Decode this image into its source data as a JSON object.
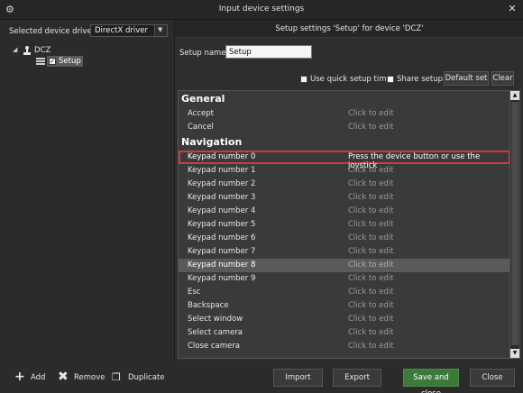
{
  "window": {
    "title": "Input device settings",
    "close_glyph": "✕",
    "icon": "gear-icon"
  },
  "left": {
    "driver_label": "Selected device driver:",
    "driver_value": "DirectX driver",
    "tree": {
      "device": "DCZ",
      "setup": "Setup"
    }
  },
  "right": {
    "header": "Setup settings 'Setup' for device 'DCZ'",
    "setup_name_label": "Setup name:",
    "setup_name_value": "Setup",
    "quick_setup_label": "Use quick setup time",
    "share_setup_label": "Share setup",
    "default_set_label": "Default set",
    "clear_label": "Clear"
  },
  "list": {
    "sections": [
      {
        "title": "General",
        "rows": [
          {
            "name": "Accept",
            "value": "Click to edit"
          },
          {
            "name": "Cancel",
            "value": "Click to edit"
          }
        ]
      },
      {
        "title": "Navigation",
        "rows": [
          {
            "name": "Keypad number 0",
            "value": "Press the device button or use the joystick"
          },
          {
            "name": "Keypad number 1",
            "value": "Click to edit"
          },
          {
            "name": "Keypad number 2",
            "value": "Click to edit"
          },
          {
            "name": "Keypad number 3",
            "value": "Click to edit"
          },
          {
            "name": "Keypad number 4",
            "value": "Click to edit"
          },
          {
            "name": "Keypad number 5",
            "value": "Click to edit"
          },
          {
            "name": "Keypad number 6",
            "value": "Click to edit"
          },
          {
            "name": "Keypad number 7",
            "value": "Click to edit"
          },
          {
            "name": "Keypad number 8",
            "value": "Click to edit"
          },
          {
            "name": "Keypad number 9",
            "value": "Click to edit"
          },
          {
            "name": "Esc",
            "value": "Click to edit"
          },
          {
            "name": "Backspace",
            "value": "Click to edit"
          },
          {
            "name": "Select window",
            "value": "Click to edit"
          },
          {
            "name": "Select camera",
            "value": "Click to edit"
          },
          {
            "name": "Close camera",
            "value": "Click to edit"
          }
        ]
      }
    ]
  },
  "bottom": {
    "add_label": "Add",
    "remove_label": "Remove",
    "duplicate_label": "Duplicate",
    "import_label": "Import",
    "export_label": "Export",
    "save_close_label": "Save and close",
    "close_label": "Close"
  },
  "colors": {
    "active_row_border": "#d23a3a",
    "highlight_row": "#5a5a5a",
    "save_button": "#3c7a3c"
  }
}
